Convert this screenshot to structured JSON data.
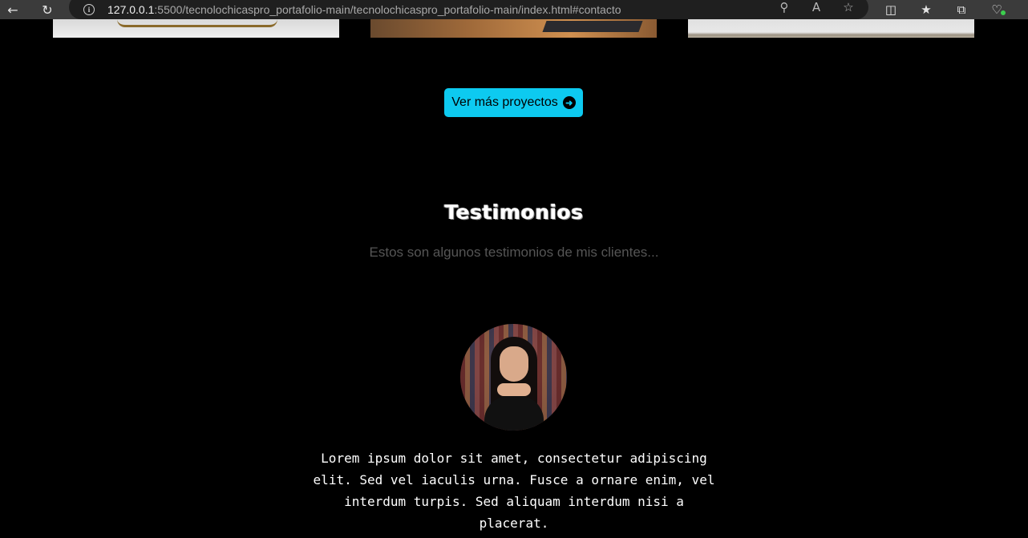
{
  "browser": {
    "url_host": "127.0.0.1",
    "url_rest": ":5500/tecnolochicaspro_portafolio-main/tecnolochicaspro_portafolio-main/index.html#contacto"
  },
  "projects": {
    "more_button_label": "Ver más proyectos"
  },
  "testimonials": {
    "title": "Testimonios",
    "subtitle": "Estos son algunos testimonios de mis clientes...",
    "items": [
      {
        "text": "Lorem ipsum dolor sit amet, consectetur adipiscing elit. Sed vel iaculis urna. Fusce a ornare enim, vel interdum turpis. Sed aliquam interdum nisi a placerat."
      }
    ]
  },
  "colors": {
    "accent": "#0dcaf0",
    "background": "#000000",
    "subtitle": "#555555"
  }
}
